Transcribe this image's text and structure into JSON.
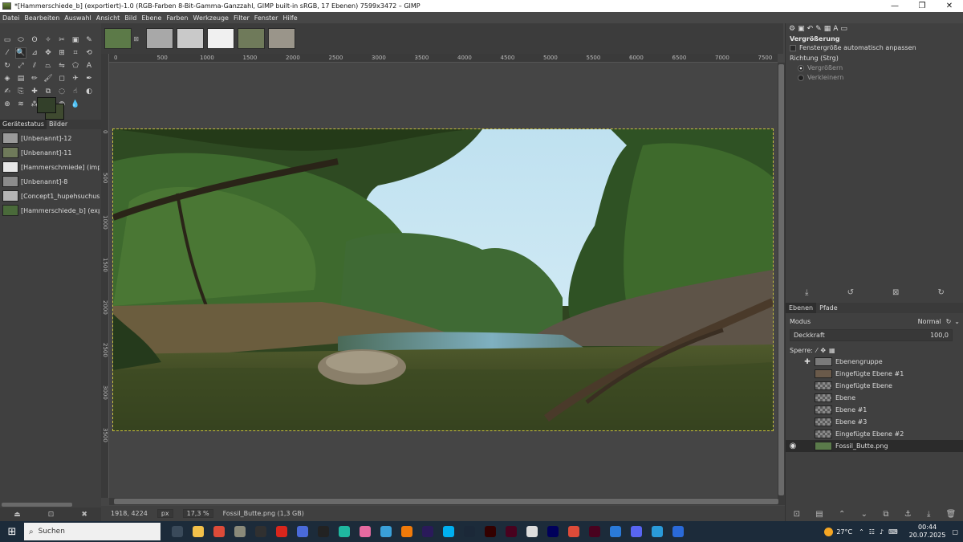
{
  "window": {
    "title": "*[Hammerschiede_b] (exportiert)-1.0 (RGB-Farben 8-Bit-Gamma-Ganzzahl, GIMP built-in sRGB, 17 Ebenen) 7599x3472 – GIMP",
    "minimize": "—",
    "maximize": "❐",
    "close": "✕"
  },
  "menu": [
    "Datei",
    "Bearbeiten",
    "Auswahl",
    "Ansicht",
    "Bild",
    "Ebene",
    "Farben",
    "Werkzeuge",
    "Filter",
    "Fenster",
    "Hilfe"
  ],
  "toolbox": {
    "tools": [
      {
        "icon": "rect-select-icon",
        "glyph": "▭"
      },
      {
        "icon": "ellipse-select-icon",
        "glyph": "⬭"
      },
      {
        "icon": "free-select-icon",
        "glyph": "ʘ"
      },
      {
        "icon": "fuzzy-select-icon",
        "glyph": "✧"
      },
      {
        "icon": "scissors-icon",
        "glyph": "✂"
      },
      {
        "icon": "foreground-select-icon",
        "glyph": "▣"
      },
      {
        "icon": "paths-icon",
        "glyph": "✎"
      },
      {
        "icon": "color-picker-icon",
        "glyph": "⁄"
      },
      {
        "icon": "zoom-icon",
        "glyph": "🔍"
      },
      {
        "icon": "measure-icon",
        "glyph": "⊿"
      },
      {
        "icon": "move-icon",
        "glyph": "✥"
      },
      {
        "icon": "align-icon",
        "glyph": "⊞"
      },
      {
        "icon": "crop-icon",
        "glyph": "⌗"
      },
      {
        "icon": "unified-transform-icon",
        "glyph": "⟲"
      },
      {
        "icon": "rotate-icon",
        "glyph": "↻"
      },
      {
        "icon": "scale-icon",
        "glyph": "⤢"
      },
      {
        "icon": "shear-icon",
        "glyph": "⫽"
      },
      {
        "icon": "perspective-icon",
        "glyph": "⏢"
      },
      {
        "icon": "flip-icon",
        "glyph": "⇋"
      },
      {
        "icon": "cage-icon",
        "glyph": "⬠"
      },
      {
        "icon": "text-icon",
        "glyph": "A"
      },
      {
        "icon": "bucket-fill-icon",
        "glyph": "◈"
      },
      {
        "icon": "gradient-icon",
        "glyph": "▤"
      },
      {
        "icon": "pencil-icon",
        "glyph": "✏"
      },
      {
        "icon": "paintbrush-icon",
        "glyph": "🖌"
      },
      {
        "icon": "eraser-icon",
        "glyph": "◻"
      },
      {
        "icon": "airbrush-icon",
        "glyph": "✈"
      },
      {
        "icon": "ink-icon",
        "glyph": "✒"
      },
      {
        "icon": "mypaint-brush-icon",
        "glyph": "✍"
      },
      {
        "icon": "clone-icon",
        "glyph": "⎘"
      },
      {
        "icon": "heal-icon",
        "glyph": "✚"
      },
      {
        "icon": "perspective-clone-icon",
        "glyph": "⧉"
      },
      {
        "icon": "blur-icon",
        "glyph": "◌"
      },
      {
        "icon": "smudge-icon",
        "glyph": "☝"
      },
      {
        "icon": "dodge-burn-icon",
        "glyph": "◐"
      },
      {
        "icon": "handle-transform-icon",
        "glyph": "⊕"
      },
      {
        "icon": "warp-icon",
        "glyph": "≋"
      },
      {
        "icon": "n-point-icon",
        "glyph": "⁂"
      },
      {
        "icon": "seamless-clone-icon",
        "glyph": "⌘"
      },
      {
        "icon": "gegl-icon",
        "glyph": "◍"
      },
      {
        "icon": "dropper-icon",
        "glyph": "💧"
      }
    ],
    "active_tool_index": 8,
    "fg_color": "#33402a",
    "bg_color": "#3f4a30",
    "tabs": [
      "Gerätestatus",
      "Bilder"
    ],
    "images": [
      {
        "name": "[Unbenannt]-12",
        "thumb": "#9a9a9a"
      },
      {
        "name": "[Unbenannt]-11",
        "thumb": "#6f7a5a"
      },
      {
        "name": "[Hammerschmiede] (impor",
        "thumb": "#e8e8e8"
      },
      {
        "name": "[Unbenannt]-8",
        "thumb": "#8c8c8c"
      },
      {
        "name": "[Concept1_hupehsuchus] (i",
        "thumb": "#b5b5b5"
      },
      {
        "name": "[Hammerschiede_b] (expor",
        "thumb": "#4a6a3a"
      }
    ]
  },
  "image_tabs": [
    {
      "thumb": "#5c7a48",
      "active": true
    },
    {
      "thumb": "#a8a8a8",
      "active": false
    },
    {
      "thumb": "#c9c9c9",
      "active": false
    },
    {
      "thumb": "#f0f0f0",
      "active": false
    },
    {
      "thumb": "#6f7a5a",
      "active": false
    },
    {
      "thumb": "#9a958a",
      "active": false
    }
  ],
  "rulers": {
    "h": [
      "0",
      "500",
      "1000",
      "1500",
      "2000",
      "2500",
      "3000",
      "3500",
      "4000",
      "4500",
      "5000",
      "5500",
      "6000",
      "6500",
      "7000",
      "7500"
    ],
    "v": [
      "0",
      "500",
      "1000",
      "1500",
      "2000",
      "2500",
      "3000",
      "3500"
    ]
  },
  "statusbar": {
    "coords": "1918, 4224",
    "unit": "px",
    "zoom": "17,3 %",
    "info": "Fossil_Butte.png (1,3 GB)"
  },
  "tool_options": {
    "title": "Vergrößerung",
    "auto_resize": "Fenstergröße automatisch anpassen",
    "direction_label": "Richtung (Strg)",
    "zoom_in": "Vergrößern",
    "zoom_out": "Verkleinern"
  },
  "layers_panel": {
    "tabs": [
      "Ebenen",
      "Pfade"
    ],
    "mode_label": "Modus",
    "mode_value": "Normal",
    "opacity_label": "Deckkraft",
    "opacity_value": "100,0",
    "lock_label": "Sperre:",
    "layers": [
      {
        "name": "Ebenengruppe",
        "visible": false,
        "thumb": "#7a7a7a",
        "group": true
      },
      {
        "name": "Eingefügte Ebene #1",
        "visible": false,
        "thumb": "#6a5a4a"
      },
      {
        "name": "Eingefügte Ebene",
        "visible": false,
        "thumb": "checker"
      },
      {
        "name": "Ebene",
        "visible": false,
        "thumb": "checker"
      },
      {
        "name": "Ebene #1",
        "visible": false,
        "thumb": "checker"
      },
      {
        "name": "Ebene #3",
        "visible": false,
        "thumb": "checker"
      },
      {
        "name": "Eingefügte Ebene #2",
        "visible": false,
        "thumb": "checker"
      },
      {
        "name": "Fossil_Butte.png",
        "visible": true,
        "thumb": "#5a7a4a",
        "selected": true
      }
    ]
  },
  "taskbar": {
    "search_placeholder": "Suchen",
    "apps": [
      {
        "icon": "task-view-icon",
        "color": "#3a4a5a"
      },
      {
        "icon": "file-explorer-icon",
        "color": "#f2c04a"
      },
      {
        "icon": "chrome-icon",
        "color": "#dd4b39"
      },
      {
        "icon": "gimp-icon",
        "color": "#8a8a7a"
      },
      {
        "icon": "obs-icon",
        "color": "#303030"
      },
      {
        "icon": "acrobat-icon",
        "color": "#d9261c"
      },
      {
        "icon": "sketch-icon",
        "color": "#4a6ad9"
      },
      {
        "icon": "opera-icon",
        "color": "#222"
      },
      {
        "icon": "chat-icon",
        "color": "#1fb8a0"
      },
      {
        "icon": "audio-icon",
        "color": "#e56aa0"
      },
      {
        "icon": "photos-icon",
        "color": "#3aa0d9"
      },
      {
        "icon": "vlc-icon",
        "color": "#f07a0a"
      },
      {
        "icon": "premiere-icon",
        "color": "#2a1a5a"
      },
      {
        "icon": "skype-icon",
        "color": "#00aff0"
      },
      {
        "icon": "steam-icon",
        "color": "#1b2838"
      },
      {
        "icon": "illustrator-icon",
        "color": "#330000"
      },
      {
        "icon": "indesign-icon",
        "color": "#49021f"
      },
      {
        "icon": "files-icon",
        "color": "#ddd"
      },
      {
        "icon": "after-effects-icon",
        "color": "#00005b"
      },
      {
        "icon": "chrome-alt-icon",
        "color": "#dd4b39"
      },
      {
        "icon": "indesign-alt-icon",
        "color": "#49021f"
      },
      {
        "icon": "calculator-icon",
        "color": "#2a7ad9"
      },
      {
        "icon": "discord-icon",
        "color": "#5865f2"
      },
      {
        "icon": "clipchamp-icon",
        "color": "#2a9ad9"
      },
      {
        "icon": "store-icon",
        "color": "#2a6ad9"
      }
    ],
    "weather": "27°C",
    "time": "00:44",
    "date": "20.07.2025"
  }
}
